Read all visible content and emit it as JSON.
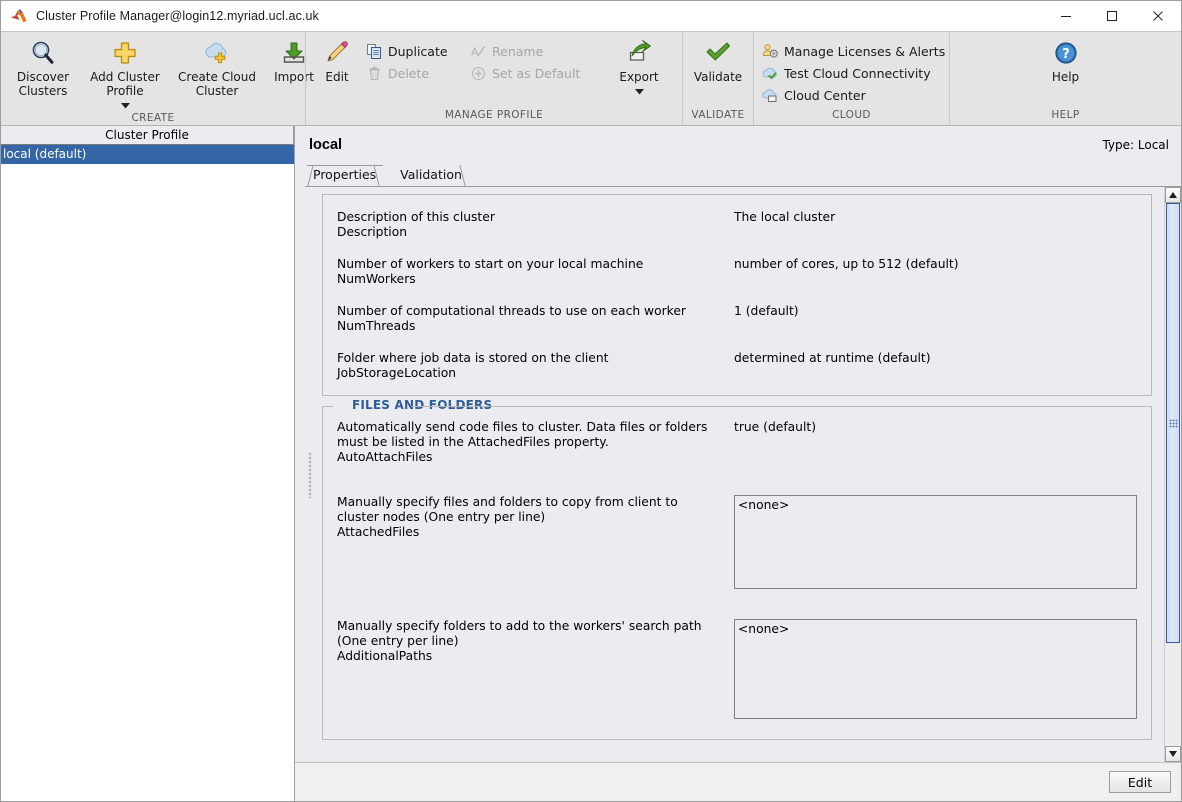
{
  "window": {
    "title": "Cluster Profile Manager@login12.myriad.ucl.ac.uk",
    "minimize": "—",
    "maximize": "□",
    "close": "✕"
  },
  "ribbon": {
    "groups": [
      {
        "label": "CREATE",
        "big": [
          {
            "icon": "magnifier-icon",
            "label": "Discover\nClusters"
          },
          {
            "icon": "plus-plate-icon",
            "label": "Add Cluster\nProfile",
            "caret": true
          },
          {
            "icon": "cloud-plus-icon",
            "label": "Create Cloud\nCluster"
          },
          {
            "icon": "import-arrow-icon",
            "label": "Import"
          }
        ],
        "small": []
      },
      {
        "label": "MANAGE PROFILE",
        "big": [
          {
            "icon": "pencil-icon",
            "label": "Edit"
          }
        ],
        "smallColumns": [
          [
            {
              "icon": "duplicate-icon",
              "label": "Duplicate",
              "disabled": false
            },
            {
              "icon": "trash-icon",
              "label": "Delete",
              "disabled": true
            }
          ],
          [
            {
              "icon": "rename-icon",
              "label": "Rename",
              "disabled": true
            },
            {
              "icon": "set-default-icon",
              "label": "Set as Default",
              "disabled": true
            }
          ]
        ],
        "bigAfter": [
          {
            "icon": "export-icon",
            "label": "Export",
            "caret": true
          }
        ]
      },
      {
        "label": "VALIDATE",
        "big": [
          {
            "icon": "check-icon",
            "label": "Validate"
          }
        ]
      },
      {
        "label": "CLOUD",
        "smallColumns": [
          [
            {
              "icon": "license-person-icon",
              "label": "Manage Licenses & Alerts"
            },
            {
              "icon": "cloud-check-icon",
              "label": "Test Cloud Connectivity"
            },
            {
              "icon": "cloud-center-icon",
              "label": "Cloud Center"
            }
          ]
        ]
      },
      {
        "label": "HELP",
        "big": [
          {
            "icon": "help-question-icon",
            "label": "Help"
          }
        ]
      }
    ]
  },
  "left_pane": {
    "header": "Cluster Profile",
    "items": [
      {
        "label": "local (default)",
        "selected": true
      }
    ]
  },
  "detail": {
    "title": "local",
    "type_label": "Type: Local",
    "tabs": [
      {
        "label": "Properties",
        "active": true
      },
      {
        "label": "Validation",
        "active": false
      }
    ],
    "main_properties": [
      {
        "desc": "Description of this cluster",
        "prop": "Description",
        "value": "The local cluster",
        "kind": "text"
      },
      {
        "desc": "Number of workers to start on your local machine",
        "prop": "NumWorkers",
        "value": "number of cores, up to 512 (default)",
        "kind": "text"
      },
      {
        "desc": "Number of computational threads to use on each worker",
        "prop": "NumThreads",
        "value": "1 (default)",
        "kind": "text"
      },
      {
        "desc": "Folder where job data is stored on the client",
        "prop": "JobStorageLocation",
        "value": "determined at runtime (default)",
        "kind": "text"
      }
    ],
    "files_group": {
      "legend": "FILES AND FOLDERS",
      "properties": [
        {
          "desc": "Automatically send code files to cluster. Data files or folders must be listed in the AttachedFiles property.",
          "prop": "AutoAttachFiles",
          "value": "true (default)",
          "kind": "text"
        },
        {
          "desc": "Manually specify files and folders to copy from client to cluster nodes (One entry per line)",
          "prop": "AttachedFiles",
          "value": "<none>",
          "kind": "box"
        },
        {
          "desc": "Manually specify folders to add to the workers' search path (One entry per line)",
          "prop": "AdditionalPaths",
          "value": "<none>",
          "kind": "box"
        }
      ]
    }
  },
  "footer": {
    "edit_label": "Edit"
  },
  "scrollbar": {
    "up_arrow": "▲",
    "down_arrow": "▼"
  },
  "colors": {
    "selection_blue": "#3465a4",
    "legend_blue": "#2d5c99",
    "panel_bg": "#ececf0",
    "ribbon_bg": "#e4e4e4"
  }
}
